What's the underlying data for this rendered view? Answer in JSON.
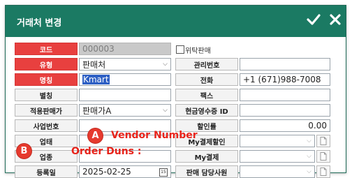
{
  "window": {
    "title": "거래처 변경"
  },
  "labels": {
    "code": "코드",
    "type": "유형",
    "name": "명칭",
    "alias": "별칭",
    "price_type": "적용판매가",
    "biz_no": "사업번호",
    "business": "업태",
    "category": "업종",
    "reg_date": "등록일",
    "mgmt_no": "관리번호",
    "phone": "전화",
    "fax": "팩스",
    "cash_receipt_id": "현금영수증 ID",
    "discount_rate": "할인률",
    "my_discount": "My결제할인",
    "my_payment": "My결제",
    "sales_rep": "판매 담당사원"
  },
  "values": {
    "code": "000003",
    "consign_checkbox_label": "위탁판매",
    "type": "판매처",
    "name": "Kmart",
    "alias": "",
    "price_type": "판매가A",
    "biz_no": "",
    "business": "",
    "category": "",
    "reg_date": "2025-02-25",
    "mgmt_no": "",
    "phone": "+1 (671)988-7008",
    "fax": "",
    "cash_receipt_id": "",
    "discount_rate": "0.00",
    "my_discount": "",
    "my_payment": "",
    "sales_rep": ""
  },
  "annotations": {
    "a_badge": "A",
    "a_text": "Vendor Number",
    "b_badge": "B",
    "b_text": "Order Duns :"
  },
  "icons": [
    "check-icon",
    "close-icon",
    "dropdown-arrow-icon",
    "calendar-icon",
    "file-icon"
  ],
  "colors": {
    "titlebar": "#1b7a63",
    "required_label": "#e8403f",
    "annotation": "#e8231a"
  }
}
